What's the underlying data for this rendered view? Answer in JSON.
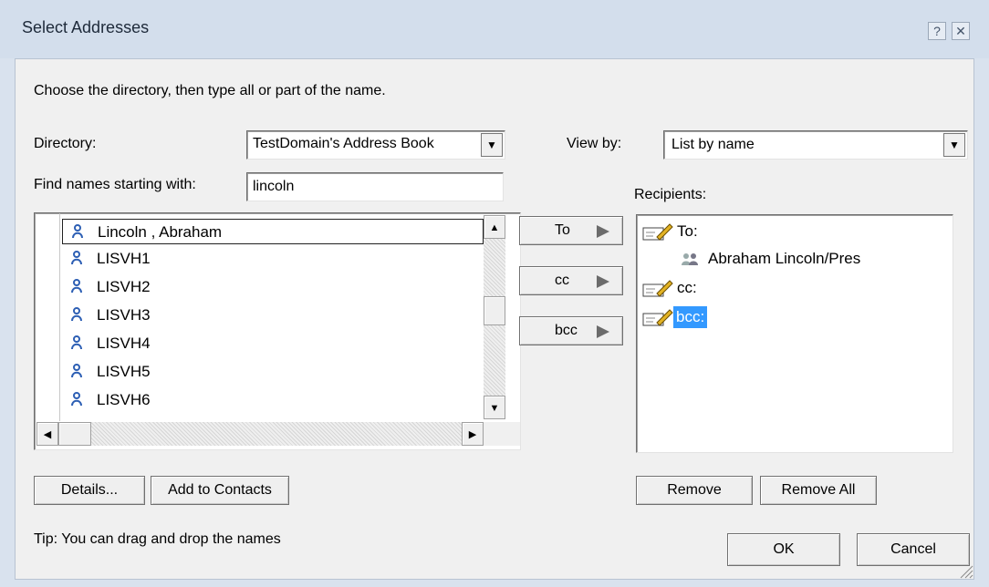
{
  "window": {
    "title": "Select Addresses",
    "help_glyph": "?",
    "close_glyph": "✕"
  },
  "instructions": "Choose the directory, then type all or part of the name.",
  "directory": {
    "label": "Directory:",
    "value": "TestDomain's Address Book"
  },
  "find": {
    "label": "Find names starting with:",
    "value": "lincoln"
  },
  "view_by": {
    "label": "View by:",
    "value": "List by name"
  },
  "names_list": {
    "items": [
      "Lincoln , Abraham",
      "LISVH1",
      "LISVH2",
      "LISVH3",
      "LISVH4",
      "LISVH5",
      "LISVH6"
    ],
    "selected_index": 0,
    "vertical_scroll_fraction": 0.45
  },
  "address_buttons": {
    "to": "To",
    "cc": "cc",
    "bcc": "bcc"
  },
  "recipients": {
    "label": "Recipients:",
    "groups": {
      "to": "To:",
      "to_entry": "Abraham Lincoln/Pres",
      "cc": "cc:",
      "bcc": "bcc:"
    },
    "selected": "bcc:"
  },
  "buttons": {
    "details": "Details...",
    "add_to_contacts": "Add to Contacts",
    "remove": "Remove",
    "remove_all": "Remove All",
    "ok": "OK",
    "cancel": "Cancel"
  },
  "tip": "Tip: You can drag and drop the names",
  "colors": {
    "selection": "#3399ff",
    "person_icon": "#2d5fb4"
  }
}
